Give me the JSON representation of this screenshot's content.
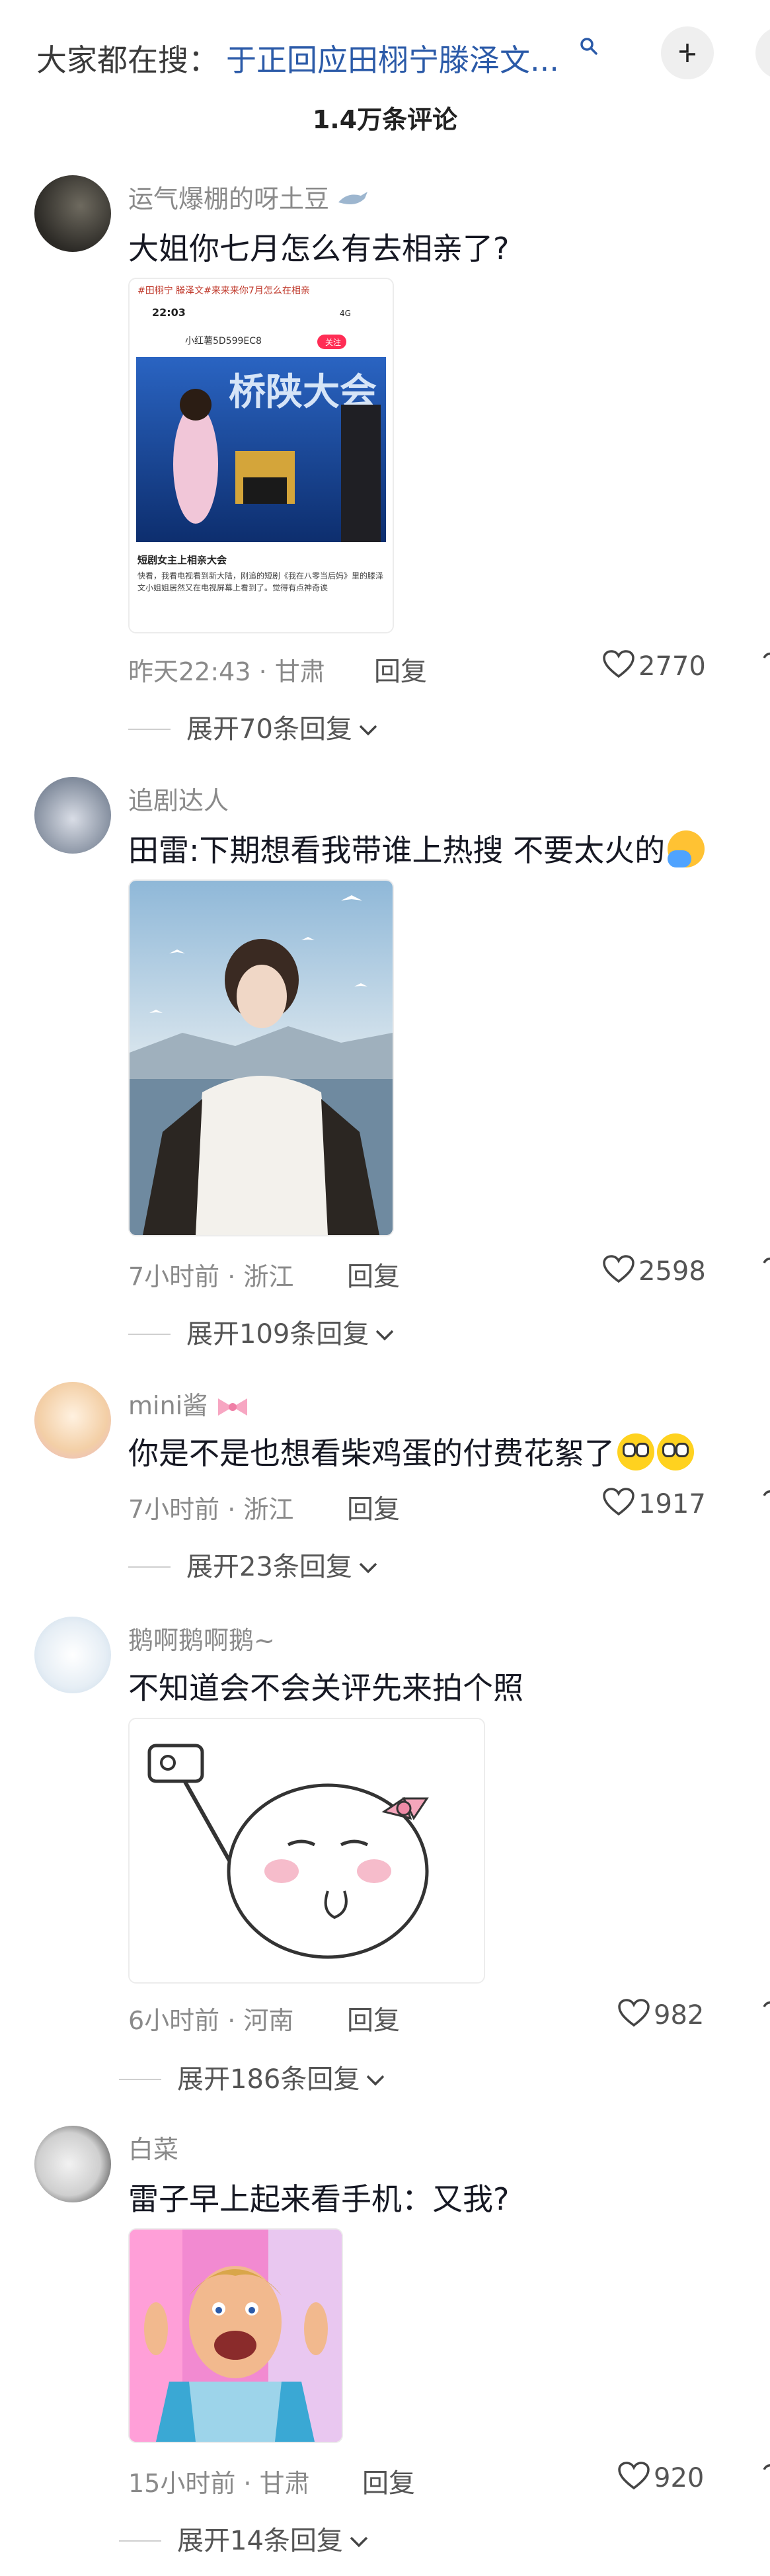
{
  "top": {
    "search_prefix": "大家都在搜：",
    "search_query": "于正回应田栩宁滕泽文...",
    "comment_count": "1.4万条评论"
  },
  "comments": [
    {
      "nick": "运气爆棚的呀土豆",
      "text": "大姐你七月怎么有去相亲了?",
      "image": {
        "header_tags": "#田栩宁 滕泽文#来来来你7月怎么在相亲",
        "status_time": "22:03",
        "status_right": "4G",
        "account": "小红薯5D599EC8",
        "follow": "关注",
        "banner": "桥陕大会",
        "caption_title": "短剧女主上相亲大会",
        "caption_body": "快看，我看电视看到新大陆，刚追的短剧《我在八零当后妈》里的滕泽文小姐姐居然又在电视屏幕上看到了。觉得有点神奇诶"
      },
      "time": "昨天22:43 · 甘肃",
      "reply": "回复",
      "likes": "2770",
      "expand": "展开70条回复"
    },
    {
      "nick": "追剧达人",
      "text": "田雷:下期想看我带谁上热搜 不要太火的",
      "time": "7小时前 · 浙江",
      "reply": "回复",
      "likes": "2598",
      "expand": "展开109条回复"
    },
    {
      "nick": "mini酱",
      "text": "你是不是也想看柴鸡蛋的付费花絮了",
      "time": "7小时前 · 浙江",
      "reply": "回复",
      "likes": "1917",
      "expand": "展开23条回复"
    },
    {
      "nick": "鹅啊鹅啊鹅~",
      "text": "不知道会不会关评先来拍个照",
      "time": "6小时前 · 河南",
      "reply": "回复",
      "likes": "982",
      "expand": "展开186条回复"
    },
    {
      "nick": "白菜",
      "text": "雷子早上起来看手机：又我?",
      "time": "15小时前 · 甘肃",
      "reply": "回复",
      "likes": "920",
      "expand": "展开14条回复"
    }
  ],
  "colors": {
    "link": "#2b5aa8",
    "muted": "#8a8a8a",
    "text": "#161823"
  },
  "icons": {
    "search": "search-icon",
    "collapse": "collapse-icon",
    "like": "heart-icon",
    "expand": "chevron-down-icon"
  }
}
